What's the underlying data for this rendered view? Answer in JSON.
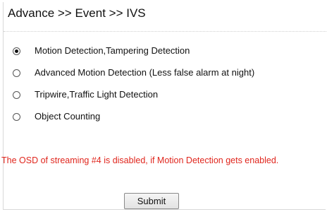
{
  "header": {
    "breadcrumb": "Advance >> Event >> IVS"
  },
  "options": [
    {
      "label": "Motion Detection,Tampering Detection",
      "selected": true
    },
    {
      "label": "Advanced Motion Detection (Less false alarm at night)",
      "selected": false
    },
    {
      "label": "Tripwire,Traffic Light Detection",
      "selected": false
    },
    {
      "label": "Object Counting",
      "selected": false
    }
  ],
  "warning": {
    "text": "The OSD of streaming #4 is disabled, if Motion Detection gets enabled.",
    "color": "#e0261d"
  },
  "submit": {
    "label": "Submit"
  }
}
